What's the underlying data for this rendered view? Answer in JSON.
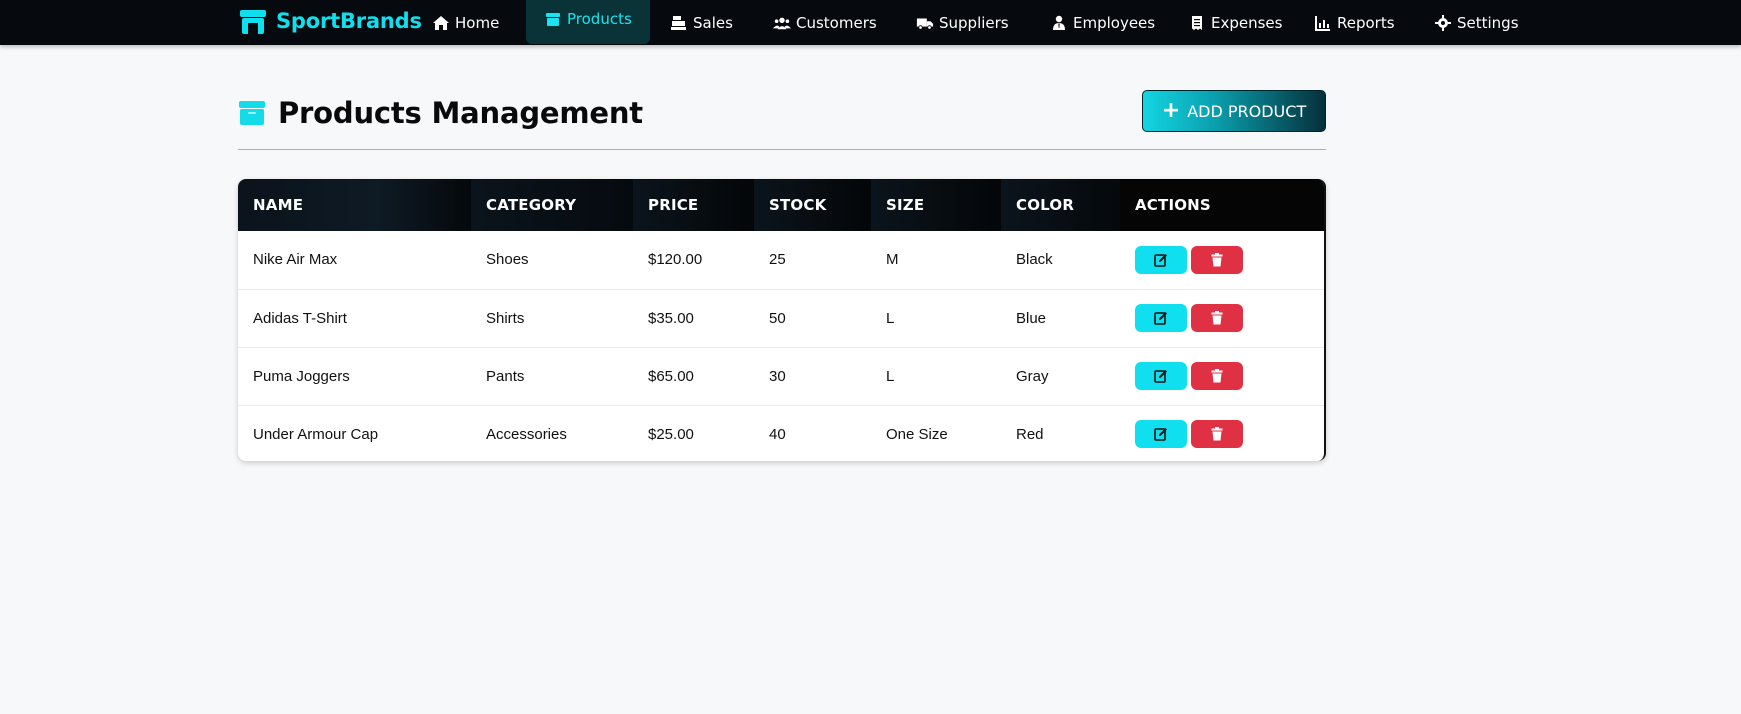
{
  "brand": {
    "name": "SportBrands",
    "icon": "store-icon",
    "color": "#0fe0ee"
  },
  "nav": [
    {
      "label": "Home",
      "icon": "home-icon",
      "active": false
    },
    {
      "label": "Products",
      "icon": "box-icon",
      "active": true
    },
    {
      "label": "Sales",
      "icon": "cash-register-icon",
      "active": false
    },
    {
      "label": "Customers",
      "icon": "users-icon",
      "active": false
    },
    {
      "label": "Suppliers",
      "icon": "truck-icon",
      "active": false
    },
    {
      "label": "Employees",
      "icon": "user-tie-icon",
      "active": false
    },
    {
      "label": "Expenses",
      "icon": "receipt-icon",
      "active": false
    },
    {
      "label": "Reports",
      "icon": "chart-line-icon",
      "active": false
    },
    {
      "label": "Settings",
      "icon": "gear-icon",
      "active": false
    }
  ],
  "page": {
    "title": "Products Management",
    "title_icon": "box-icon",
    "add_button": "ADD PRODUCT"
  },
  "table": {
    "columns": [
      "NAME",
      "CATEGORY",
      "PRICE",
      "STOCK",
      "SIZE",
      "COLOR",
      "ACTIONS"
    ],
    "rows": [
      {
        "name": "Nike Air Max",
        "category": "Shoes",
        "price": "$120.00",
        "stock": "25",
        "size": "M",
        "color": "Black"
      },
      {
        "name": "Adidas T-Shirt",
        "category": "Shirts",
        "price": "$35.00",
        "stock": "50",
        "size": "L",
        "color": "Blue"
      },
      {
        "name": "Puma Joggers",
        "category": "Pants",
        "price": "$65.00",
        "stock": "30",
        "size": "L",
        "color": "Gray"
      },
      {
        "name": "Under Armour Cap",
        "category": "Accessories",
        "price": "$25.00",
        "stock": "40",
        "size": "One Size",
        "color": "Red"
      }
    ],
    "edit_icon": "edit-icon",
    "delete_icon": "trash-icon"
  },
  "colors": {
    "accent": "#10dff0",
    "danger": "#e03144",
    "nav_bg": "#06090d"
  }
}
